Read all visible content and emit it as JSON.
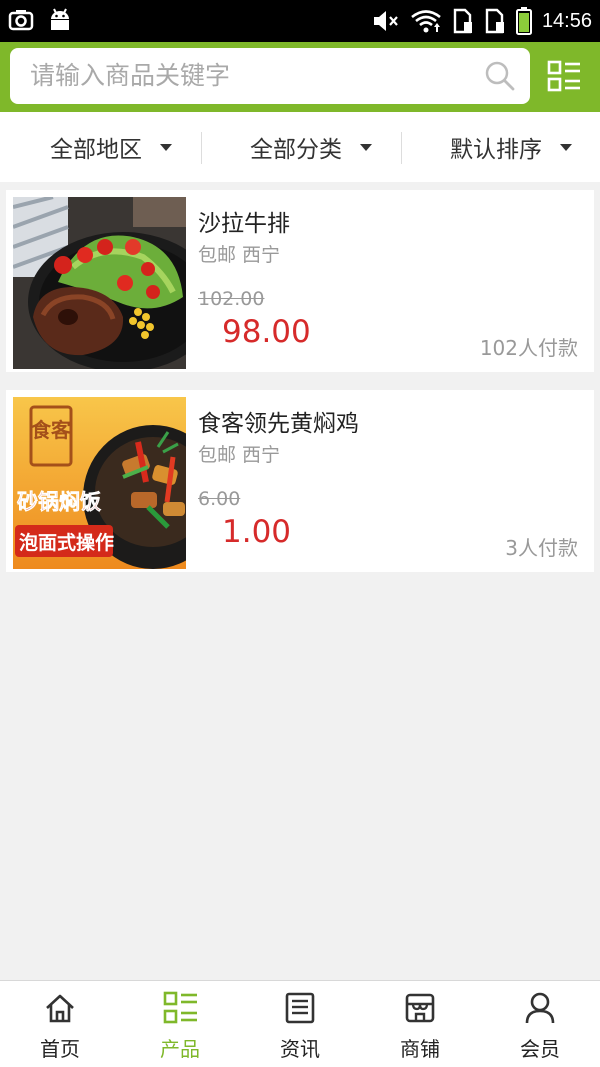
{
  "status_bar": {
    "time": "14:56",
    "icons": [
      "screenshot-icon",
      "android-icon",
      "mute-icon",
      "wifi-icon",
      "sim1-icon",
      "sim2-icon",
      "battery-icon"
    ]
  },
  "header": {
    "search_placeholder": "请输入商品关键字",
    "accent_color": "#7fb82a"
  },
  "filters": [
    {
      "label": "全部地区"
    },
    {
      "label": "全部分类"
    },
    {
      "label": "默认排序"
    }
  ],
  "products": [
    {
      "title": "沙拉牛排",
      "location": "包邮 西宁",
      "original_price": "102.00",
      "price": "98.00",
      "paid": "102人付款"
    },
    {
      "title": "食客领先黄焖鸡",
      "location": "包邮 西宁",
      "original_price": "6.00",
      "price": "1.00",
      "paid": "3人付款",
      "image_text_1": "砂锅焖饭",
      "image_text_2": "泡面式操作",
      "image_logo": "食客"
    }
  ],
  "bottom_nav": [
    {
      "label": "首页",
      "icon": "home-icon",
      "active": false
    },
    {
      "label": "产品",
      "icon": "list-icon",
      "active": true
    },
    {
      "label": "资讯",
      "icon": "news-icon",
      "active": false
    },
    {
      "label": "商铺",
      "icon": "shop-icon",
      "active": false
    },
    {
      "label": "会员",
      "icon": "user-icon",
      "active": false
    }
  ]
}
